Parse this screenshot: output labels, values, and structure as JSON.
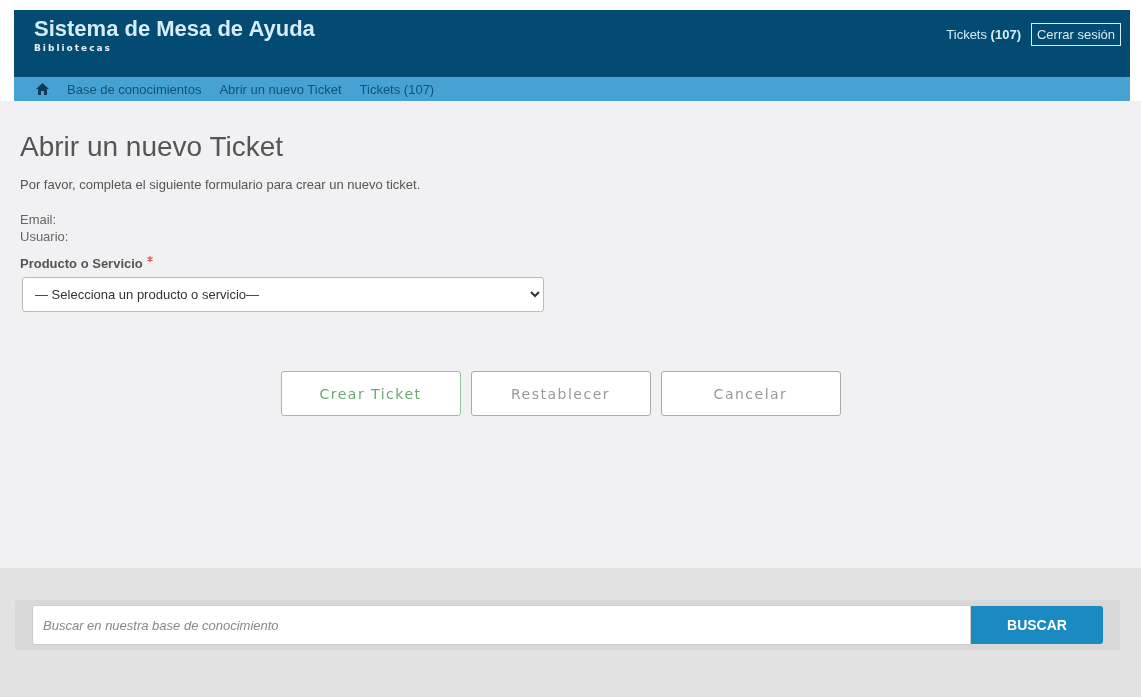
{
  "header": {
    "title": "Sistema de Mesa de Ayuda",
    "subtitle": "Bibliotecas",
    "tickets_link": "Tickets **(107)**",
    "logout": "Cerrar sesión"
  },
  "nav": {
    "items": [
      "Base de conocimientos",
      "Abrir un nuevo Ticket",
      "Tickets (107)"
    ]
  },
  "page": {
    "title": "Abrir un nuevo Ticket",
    "intro": "Por favor, completa el siguiente formulario para crear un nuevo ticket.",
    "info": [
      "Email:",
      "Usuario:"
    ],
    "product_field": {
      "label": "Producto o Servicio",
      "required": true,
      "value": "— Selecciona un producto o servicio—"
    },
    "buttons": [
      {
        "label": "Crear Ticket",
        "kind": "primary"
      },
      {
        "label": "Restablecer",
        "kind": "default"
      },
      {
        "label": "Cancelar",
        "kind": "default"
      }
    ]
  },
  "search": {
    "placeholder": "Buscar en nuestra base de conocimiento",
    "button": "BUSCAR"
  }
}
